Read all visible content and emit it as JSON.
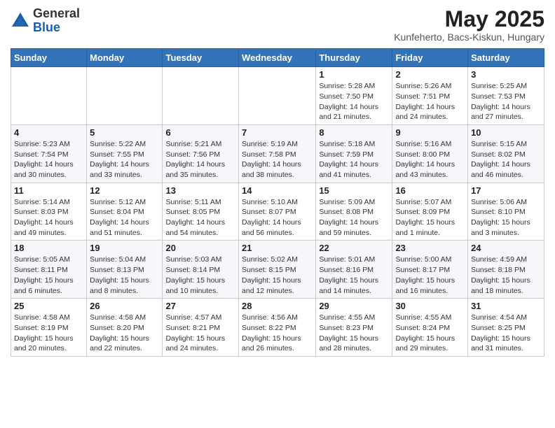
{
  "header": {
    "logo_general": "General",
    "logo_blue": "Blue",
    "month_title": "May 2025",
    "subtitle": "Kunfeherto, Bacs-Kiskun, Hungary"
  },
  "days_of_week": [
    "Sunday",
    "Monday",
    "Tuesday",
    "Wednesday",
    "Thursday",
    "Friday",
    "Saturday"
  ],
  "weeks": [
    [
      {
        "day": "",
        "info": ""
      },
      {
        "day": "",
        "info": ""
      },
      {
        "day": "",
        "info": ""
      },
      {
        "day": "",
        "info": ""
      },
      {
        "day": "1",
        "info": "Sunrise: 5:28 AM\nSunset: 7:50 PM\nDaylight: 14 hours\nand 21 minutes."
      },
      {
        "day": "2",
        "info": "Sunrise: 5:26 AM\nSunset: 7:51 PM\nDaylight: 14 hours\nand 24 minutes."
      },
      {
        "day": "3",
        "info": "Sunrise: 5:25 AM\nSunset: 7:53 PM\nDaylight: 14 hours\nand 27 minutes."
      }
    ],
    [
      {
        "day": "4",
        "info": "Sunrise: 5:23 AM\nSunset: 7:54 PM\nDaylight: 14 hours\nand 30 minutes."
      },
      {
        "day": "5",
        "info": "Sunrise: 5:22 AM\nSunset: 7:55 PM\nDaylight: 14 hours\nand 33 minutes."
      },
      {
        "day": "6",
        "info": "Sunrise: 5:21 AM\nSunset: 7:56 PM\nDaylight: 14 hours\nand 35 minutes."
      },
      {
        "day": "7",
        "info": "Sunrise: 5:19 AM\nSunset: 7:58 PM\nDaylight: 14 hours\nand 38 minutes."
      },
      {
        "day": "8",
        "info": "Sunrise: 5:18 AM\nSunset: 7:59 PM\nDaylight: 14 hours\nand 41 minutes."
      },
      {
        "day": "9",
        "info": "Sunrise: 5:16 AM\nSunset: 8:00 PM\nDaylight: 14 hours\nand 43 minutes."
      },
      {
        "day": "10",
        "info": "Sunrise: 5:15 AM\nSunset: 8:02 PM\nDaylight: 14 hours\nand 46 minutes."
      }
    ],
    [
      {
        "day": "11",
        "info": "Sunrise: 5:14 AM\nSunset: 8:03 PM\nDaylight: 14 hours\nand 49 minutes."
      },
      {
        "day": "12",
        "info": "Sunrise: 5:12 AM\nSunset: 8:04 PM\nDaylight: 14 hours\nand 51 minutes."
      },
      {
        "day": "13",
        "info": "Sunrise: 5:11 AM\nSunset: 8:05 PM\nDaylight: 14 hours\nand 54 minutes."
      },
      {
        "day": "14",
        "info": "Sunrise: 5:10 AM\nSunset: 8:07 PM\nDaylight: 14 hours\nand 56 minutes."
      },
      {
        "day": "15",
        "info": "Sunrise: 5:09 AM\nSunset: 8:08 PM\nDaylight: 14 hours\nand 59 minutes."
      },
      {
        "day": "16",
        "info": "Sunrise: 5:07 AM\nSunset: 8:09 PM\nDaylight: 15 hours\nand 1 minute."
      },
      {
        "day": "17",
        "info": "Sunrise: 5:06 AM\nSunset: 8:10 PM\nDaylight: 15 hours\nand 3 minutes."
      }
    ],
    [
      {
        "day": "18",
        "info": "Sunrise: 5:05 AM\nSunset: 8:11 PM\nDaylight: 15 hours\nand 6 minutes."
      },
      {
        "day": "19",
        "info": "Sunrise: 5:04 AM\nSunset: 8:13 PM\nDaylight: 15 hours\nand 8 minutes."
      },
      {
        "day": "20",
        "info": "Sunrise: 5:03 AM\nSunset: 8:14 PM\nDaylight: 15 hours\nand 10 minutes."
      },
      {
        "day": "21",
        "info": "Sunrise: 5:02 AM\nSunset: 8:15 PM\nDaylight: 15 hours\nand 12 minutes."
      },
      {
        "day": "22",
        "info": "Sunrise: 5:01 AM\nSunset: 8:16 PM\nDaylight: 15 hours\nand 14 minutes."
      },
      {
        "day": "23",
        "info": "Sunrise: 5:00 AM\nSunset: 8:17 PM\nDaylight: 15 hours\nand 16 minutes."
      },
      {
        "day": "24",
        "info": "Sunrise: 4:59 AM\nSunset: 8:18 PM\nDaylight: 15 hours\nand 18 minutes."
      }
    ],
    [
      {
        "day": "25",
        "info": "Sunrise: 4:58 AM\nSunset: 8:19 PM\nDaylight: 15 hours\nand 20 minutes."
      },
      {
        "day": "26",
        "info": "Sunrise: 4:58 AM\nSunset: 8:20 PM\nDaylight: 15 hours\nand 22 minutes."
      },
      {
        "day": "27",
        "info": "Sunrise: 4:57 AM\nSunset: 8:21 PM\nDaylight: 15 hours\nand 24 minutes."
      },
      {
        "day": "28",
        "info": "Sunrise: 4:56 AM\nSunset: 8:22 PM\nDaylight: 15 hours\nand 26 minutes."
      },
      {
        "day": "29",
        "info": "Sunrise: 4:55 AM\nSunset: 8:23 PM\nDaylight: 15 hours\nand 28 minutes."
      },
      {
        "day": "30",
        "info": "Sunrise: 4:55 AM\nSunset: 8:24 PM\nDaylight: 15 hours\nand 29 minutes."
      },
      {
        "day": "31",
        "info": "Sunrise: 4:54 AM\nSunset: 8:25 PM\nDaylight: 15 hours\nand 31 minutes."
      }
    ]
  ]
}
